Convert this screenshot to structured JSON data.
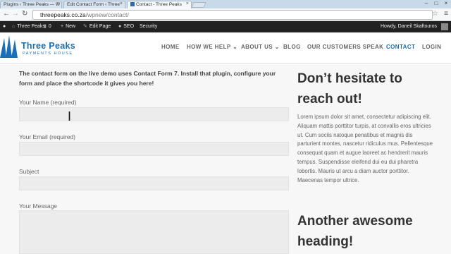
{
  "browser": {
    "tabs": [
      {
        "title": "Plugins ‹ Three Peaks — W"
      },
      {
        "title": "Edit Contact Form ‹ Three"
      },
      {
        "title": "Contact - Three Peaks"
      }
    ],
    "url_host": "threepeaks.co.za",
    "url_path": "/wpnew/contact/"
  },
  "adminbar": {
    "site_name": "Three Peaks",
    "comments_count": "0",
    "new_label": "New",
    "edit_page_label": "Edit Page",
    "seo_label": "SEO",
    "security_label": "Security",
    "greeting": "Howdy, Daneil Skaftouros"
  },
  "site": {
    "logo_title": "Three Peaks",
    "logo_subtitle": "PAYMENTS HOUSE",
    "nav": [
      {
        "label": "HOME"
      },
      {
        "label": "HOW WE HELP ⌄"
      },
      {
        "label": "ABOUT US ⌄"
      },
      {
        "label": "BLOG"
      },
      {
        "label": "OUR CUSTOMERS SPEAK"
      },
      {
        "label": "CONTACT"
      },
      {
        "label": "LOGIN"
      }
    ],
    "brand_color": "#1a6fb8"
  },
  "form": {
    "intro": "The contact form on the live demo uses Contact Form 7. Install that plugin, configure your form and place the shortcode it gives you here!",
    "name_label": "Your Name (required)",
    "email_label": "Your Email (required)",
    "subject_label": "Subject",
    "message_label": "Your Message"
  },
  "sidebar": {
    "heading1": "Don’t hesitate to reach out!",
    "body": "Lorem ipsum dolor sit amet, consectetur adipiscing elit. Aliquam mattis porttitor turpis, at convallis eros ultricies ut. Cum sociis natoque penatibus et magnis dis parturient montes, nascetur ridiculus mus. Pellentesque consequat quam et augue laoreet ac hendrerit mauris tempus. Suspendisse eleifend dui eu dui pharetra lobortis. Mauris ut arcu a diam auctor porttitor. Maecenas tempor ultrice.",
    "heading2": "Another awesome heading!"
  }
}
